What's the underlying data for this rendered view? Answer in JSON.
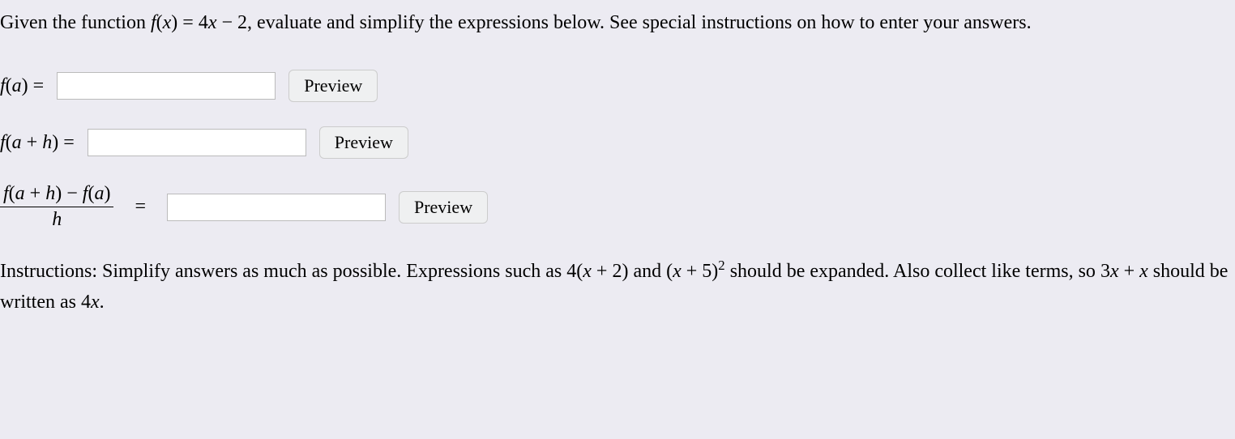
{
  "intro": {
    "part1": "Given the function ",
    "fx": "f",
    "openParen": "(",
    "x": "x",
    "closeParen": ")",
    "eq": " = ",
    "rhs1": "4",
    "rhsX": "x",
    "minus": " − ",
    "rhs2": "2",
    "part2": ", evaluate and simplify the expressions below. See special instructions on how to enter your answers."
  },
  "row1": {
    "label_f": "f",
    "label_open": "(",
    "label_a": "a",
    "label_close": ")",
    "eq": " = ",
    "preview": "Preview"
  },
  "row2": {
    "label_f": "f",
    "label_open": "(",
    "label_a": "a",
    "plus": " + ",
    "label_h": "h",
    "label_close": ")",
    "eq": " = ",
    "preview": "Preview"
  },
  "row3": {
    "num_f1": "f",
    "num_open1": "(",
    "num_a1": "a",
    "num_plus": " + ",
    "num_h1": "h",
    "num_close1": ")",
    "num_minus": " − ",
    "num_f2": "f",
    "num_open2": "(",
    "num_a2": "a",
    "num_close2": ")",
    "den_h": "h",
    "eq": " = ",
    "preview": "Preview"
  },
  "instructions": {
    "part1": "Instructions: Simplify answers as much as possible. Expressions such as ",
    "expr1a": "4(",
    "expr1x": "x",
    "expr1b": " + 2)",
    "and": " and ",
    "expr2open": "(",
    "expr2x": "x",
    "expr2plus": " + 5)",
    "sup": "2",
    "part2": " should be expanded. Also collect like terms, so ",
    "expr3a": "3",
    "expr3x1": "x",
    "expr3plus": " + ",
    "expr3x2": "x",
    "part3": " should be written as ",
    "expr4a": "4",
    "expr4x": "x",
    "period": "."
  }
}
